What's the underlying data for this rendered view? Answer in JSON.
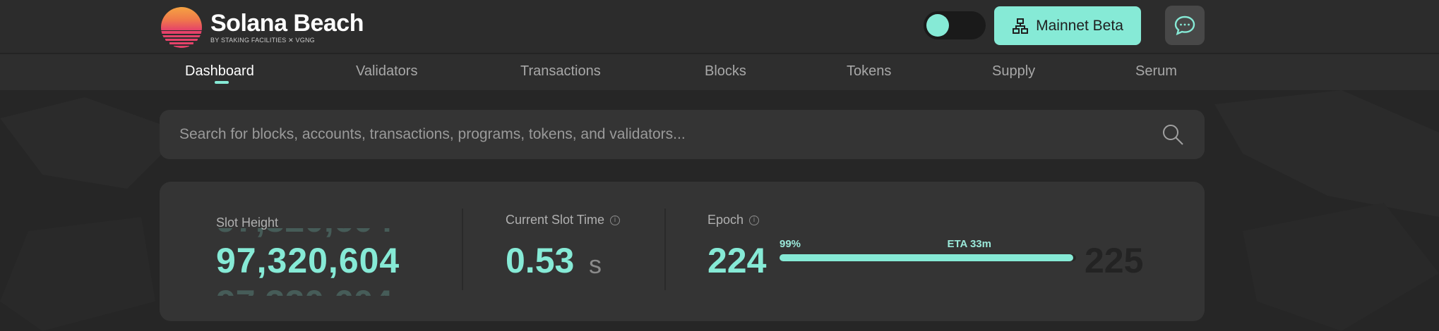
{
  "app": {
    "name": "Solana Beach",
    "subtitle": "BY STAKING FACILITIES ✕ VGNG"
  },
  "header": {
    "theme_toggle": {
      "state": "dark"
    },
    "network_button": {
      "label": "Mainnet Beta",
      "icon": "network-icon"
    },
    "chat_button": {
      "icon": "chat-icon"
    }
  },
  "nav": {
    "items": [
      {
        "label": "Dashboard",
        "active": true
      },
      {
        "label": "Validators"
      },
      {
        "label": "Transactions"
      },
      {
        "label": "Blocks"
      },
      {
        "label": "Tokens"
      },
      {
        "label": "Supply"
      },
      {
        "label": "Serum"
      }
    ]
  },
  "search": {
    "placeholder": "Search for blocks, accounts, transactions, programs, tokens, and validators...",
    "value": "",
    "icon": "search-icon"
  },
  "stats": {
    "slot_height": {
      "label": "Slot Height",
      "value": "97,320,604"
    },
    "slot_time": {
      "label": "Current Slot Time",
      "value": "0.53",
      "unit": "s"
    },
    "epoch": {
      "label": "Epoch",
      "current": "224",
      "next": "225",
      "progress_percent": 99,
      "progress_label": "99%",
      "eta": "ETA 33m"
    }
  },
  "colors": {
    "accent": "#86ead6",
    "background": "#262626",
    "card": "#343434"
  }
}
